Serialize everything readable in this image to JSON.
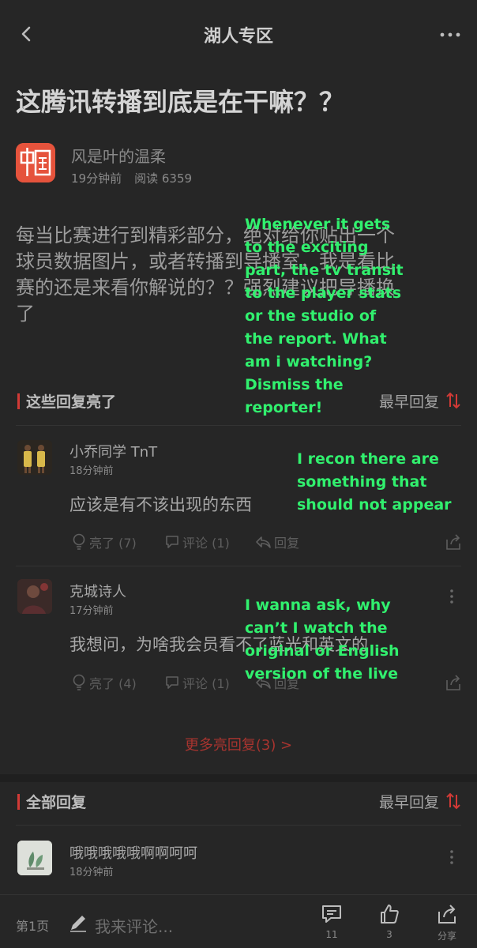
{
  "header": {
    "title": "湖人专区",
    "back_icon": "chevron-left-icon",
    "more_icon": "more-dots-icon"
  },
  "post": {
    "title": "这腾讯转播到底是在干嘛？？",
    "author": "风是叶的温柔",
    "time": "19分钟前",
    "reads": "阅读 6359",
    "avatar_text": "中国",
    "body_lines": [
      "每当比赛进行到精彩部分，绝对给你贴出一个",
      "球员数据图片，或者转播到导播室，我是看比",
      "赛的还是来看你解说的？？强烈建议把导播换",
      "了"
    ]
  },
  "hot_section": {
    "label": "这些回复亮了",
    "sort": "最早回复"
  },
  "hot_comments": [
    {
      "name": "小乔同学 TnT",
      "time": "18分钟前",
      "text": "应该是有不该出现的东西",
      "likes": "亮了 (7)",
      "comments": "评论 (1)",
      "reply": "回复"
    },
    {
      "name": "克城诗人",
      "time": "17分钟前",
      "text": "我想问，为啥我会员看不了蓝光和英文的",
      "likes": "亮了 (4)",
      "comments": "评论 (1)",
      "reply": "回复"
    }
  ],
  "more_replies": "更多亮回复(3) >",
  "all_section": {
    "label": "全部回复",
    "sort": "最早回复"
  },
  "all_comments": [
    {
      "name": "哦哦哦哦哦啊啊呵呵",
      "time": "18分钟前"
    }
  ],
  "annotations": {
    "a1": [
      "Whenever it gets",
      "to the exciting",
      "part, the tv transit",
      "to the player stats",
      "or the studio of",
      "the report. What",
      "am i watching?",
      "Dismiss the",
      "reporter!"
    ],
    "a2": [
      "I recon there are",
      "something that",
      "should not appear"
    ],
    "a3": [
      "I wanna ask, why",
      "can’t I watch the",
      "original or English",
      "version of the live"
    ],
    "color": "#31f06e"
  },
  "bottom_bar": {
    "page": "第1页",
    "placeholder": "我来评论...",
    "comment_count": "11",
    "like_count": "3",
    "share_label": "分享"
  },
  "colors": {
    "background": "#262626",
    "accent": "#d23a36"
  }
}
